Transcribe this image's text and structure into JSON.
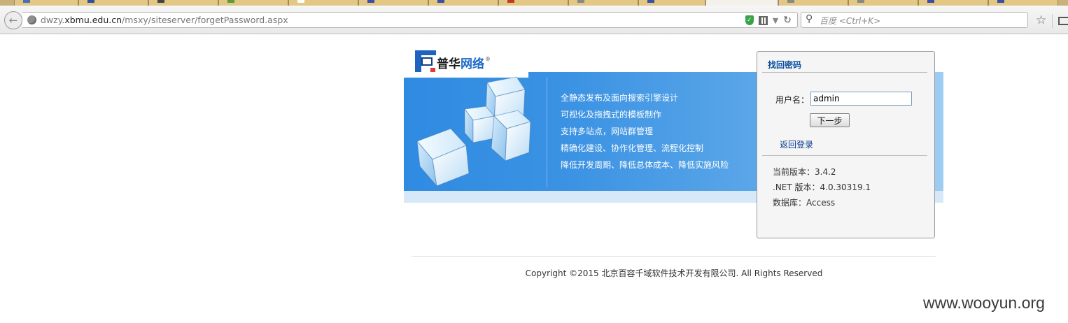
{
  "browser": {
    "url_prefix": "dwzy.",
    "url_domain": "xbmu.edu.cn",
    "url_path": "/msxy/siteserver/forgetPassword.aspx",
    "search_placeholder": "百度 <Ctrl+K>"
  },
  "logo": {
    "text_part1": "普华",
    "text_part2": "网络",
    "registered": "®"
  },
  "features": [
    "全静态发布及面向搜索引擎设计",
    "可视化及拖拽式的模板制作",
    "支持多站点，网站群管理",
    "精确化建设、协作化管理、流程化控制",
    "降低开发周期、降低总体成本、降低实施风险"
  ],
  "panel": {
    "title": "找回密码",
    "username_label": "用户名：",
    "username_value": "admin",
    "next_button": "下一步",
    "back_link": "返回登录",
    "version": "当前版本：3.4.2",
    "net_version": ".NET 版本：4.0.30319.1",
    "database": "数据库：Access"
  },
  "footer": {
    "copyright": "Copyright ©2015 北京百容千域软件技术开发有限公司. All Rights Reserved"
  },
  "watermark": "www.wooyun.org",
  "colors": {
    "banner_blue": "#2f8be2",
    "panel_title": "#0b4fa0",
    "link": "#0b3d91"
  }
}
